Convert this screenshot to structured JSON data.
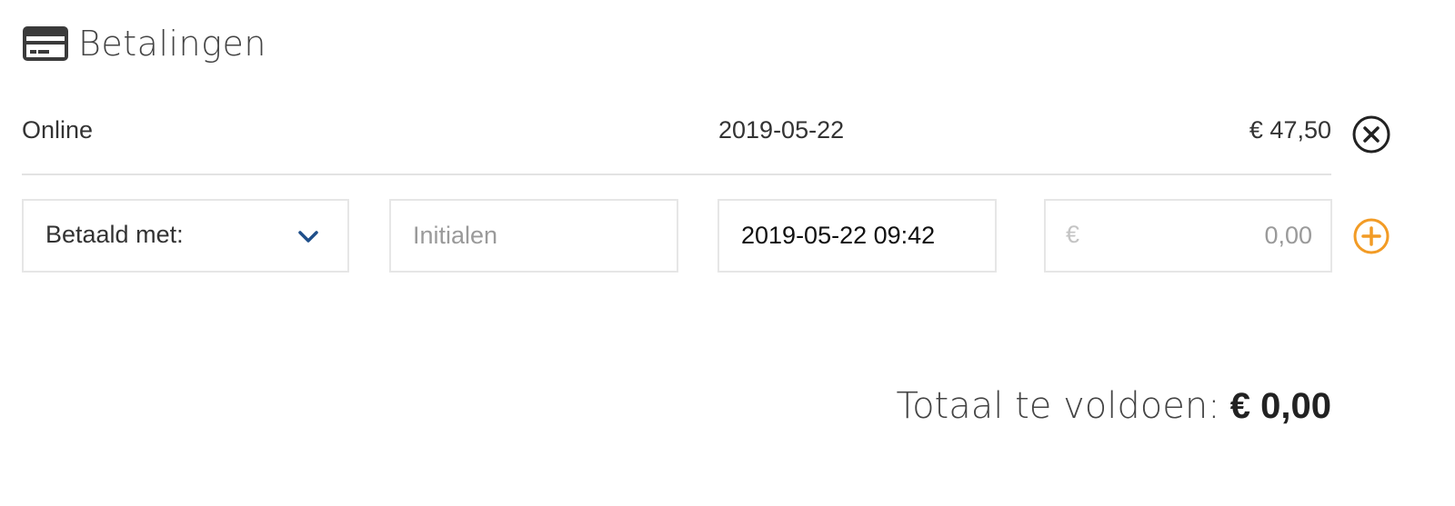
{
  "section": {
    "title": "Betalingen",
    "icon": "credit-card-icon"
  },
  "payment": {
    "method": "Online",
    "date": "2019-05-22",
    "amount": "€ 47,50",
    "remove_icon": "close-circle-icon"
  },
  "form": {
    "method_select": {
      "selected": "Betaald met:",
      "icon": "chevron-down-icon"
    },
    "initials": {
      "value": "",
      "placeholder": "Initialen"
    },
    "datetime": {
      "value": "2019-05-22 09:42",
      "placeholder": ""
    },
    "amount": {
      "currency": "€",
      "value": "",
      "placeholder": "0,00"
    },
    "add_icon": "plus-circle-icon"
  },
  "total": {
    "label": "Totaal te voldoen:",
    "value": "€ 0,00"
  },
  "colors": {
    "accent_orange": "#f29b25",
    "chevron_blue": "#1f4f8a",
    "border": "#e6e6e6",
    "divider": "#e3e3e3"
  }
}
